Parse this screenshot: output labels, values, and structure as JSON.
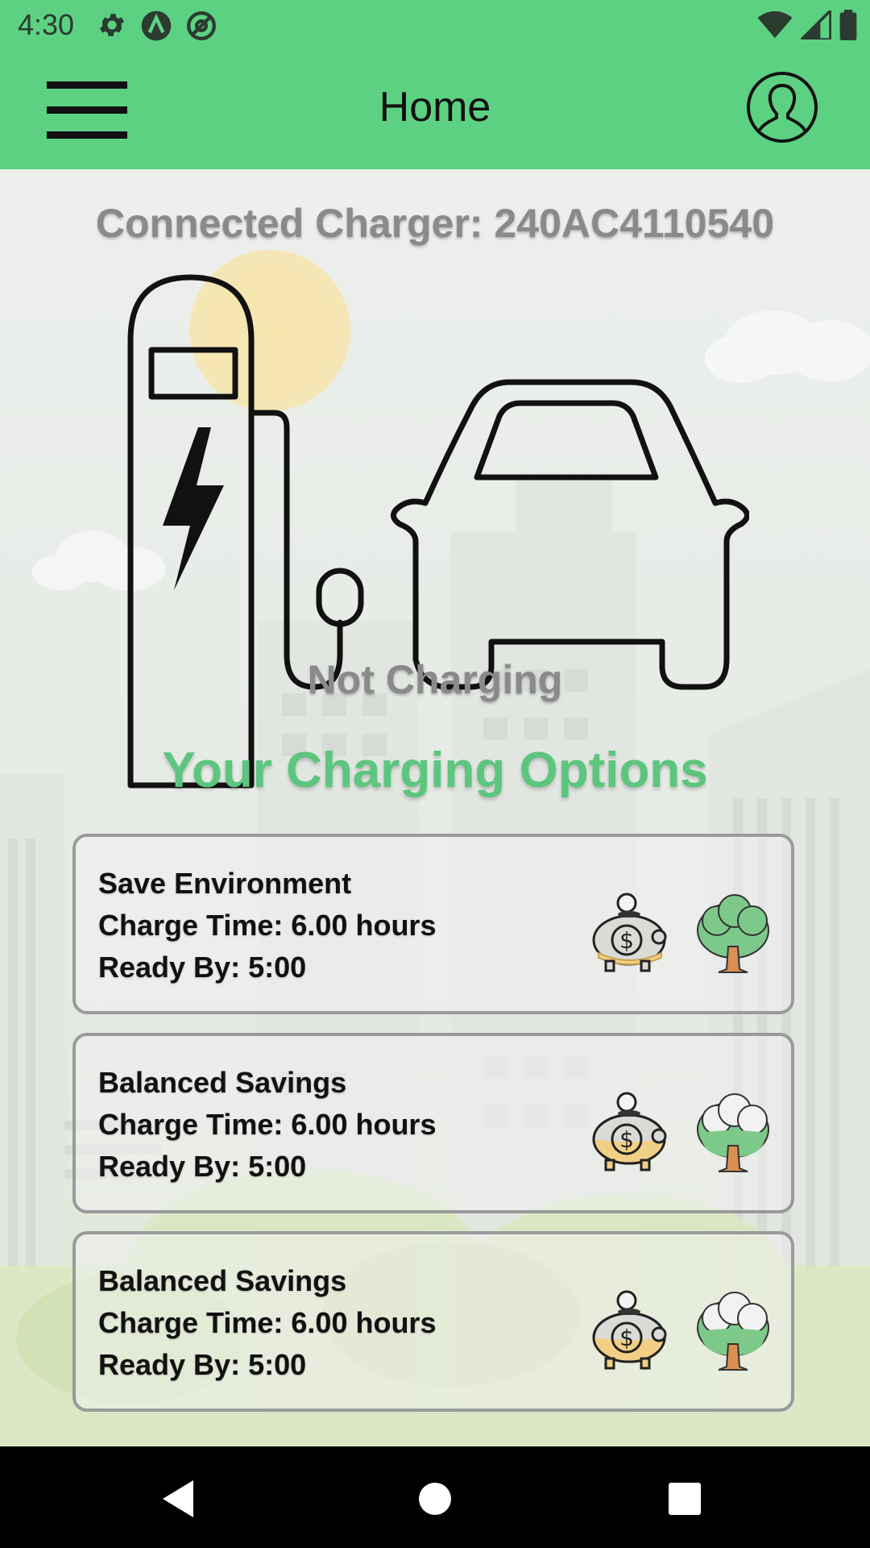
{
  "status_bar": {
    "time": "4:30",
    "icons_left": [
      "gear-icon",
      "app-a-icon",
      "at-icon"
    ],
    "icons_right": [
      "wifi-icon",
      "signal-icon",
      "battery-icon"
    ]
  },
  "app_bar": {
    "title": "Home",
    "menu_icon": "hamburger-menu-icon",
    "profile_icon": "profile-icon"
  },
  "charger": {
    "label": "Connected Charger: 240AC4110540",
    "status": "Not Charging"
  },
  "options": {
    "title": "Your Charging Options",
    "items": [
      {
        "name": "Save Environment",
        "charge_time": "Charge Time: 6.00 hours",
        "ready_by": "Ready By: 5:00",
        "savings_level": 0.15,
        "environment_level": 1.0
      },
      {
        "name": "Balanced Savings",
        "charge_time": "Charge Time: 6.00 hours",
        "ready_by": "Ready By: 5:00",
        "savings_level": 0.5,
        "environment_level": 0.5
      },
      {
        "name": "Balanced Savings",
        "charge_time": "Charge Time: 6.00 hours",
        "ready_by": "Ready By: 5:00",
        "savings_level": 0.5,
        "environment_level": 0.5
      }
    ]
  },
  "colors": {
    "accent": "#5dd182",
    "title_green": "#5cc57e",
    "gray_text": "#8a8a8a"
  },
  "nav_bar": {
    "buttons": [
      "back-icon",
      "home-icon",
      "recents-icon"
    ]
  }
}
